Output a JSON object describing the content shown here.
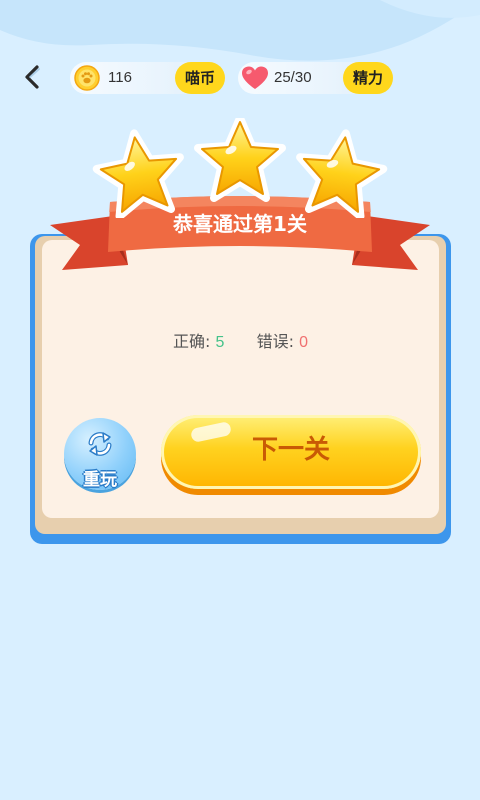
{
  "header": {
    "back_icon": "chevron-left-icon",
    "coins": {
      "icon": "paw-coin-icon",
      "value": "116",
      "label": "喵币"
    },
    "energy": {
      "icon": "heart-icon",
      "value": "25/30",
      "label": "精力"
    }
  },
  "result": {
    "stars_earned": 3,
    "stars_total": 3,
    "title": "恭喜通过第1关",
    "correct_label": "正确:",
    "correct_value": "5",
    "wrong_label": "错误:",
    "wrong_value": "0"
  },
  "actions": {
    "replay_label": "重玩",
    "replay_icon": "refresh-icon",
    "next_label": "下一关"
  },
  "colors": {
    "background": "#d9efff",
    "card_border": "#3d96ec",
    "ribbon": "#e95a35",
    "next_button": "#ffd21f",
    "tag": "#ffd71c",
    "correct": "#46c28a",
    "wrong": "#f07070"
  }
}
